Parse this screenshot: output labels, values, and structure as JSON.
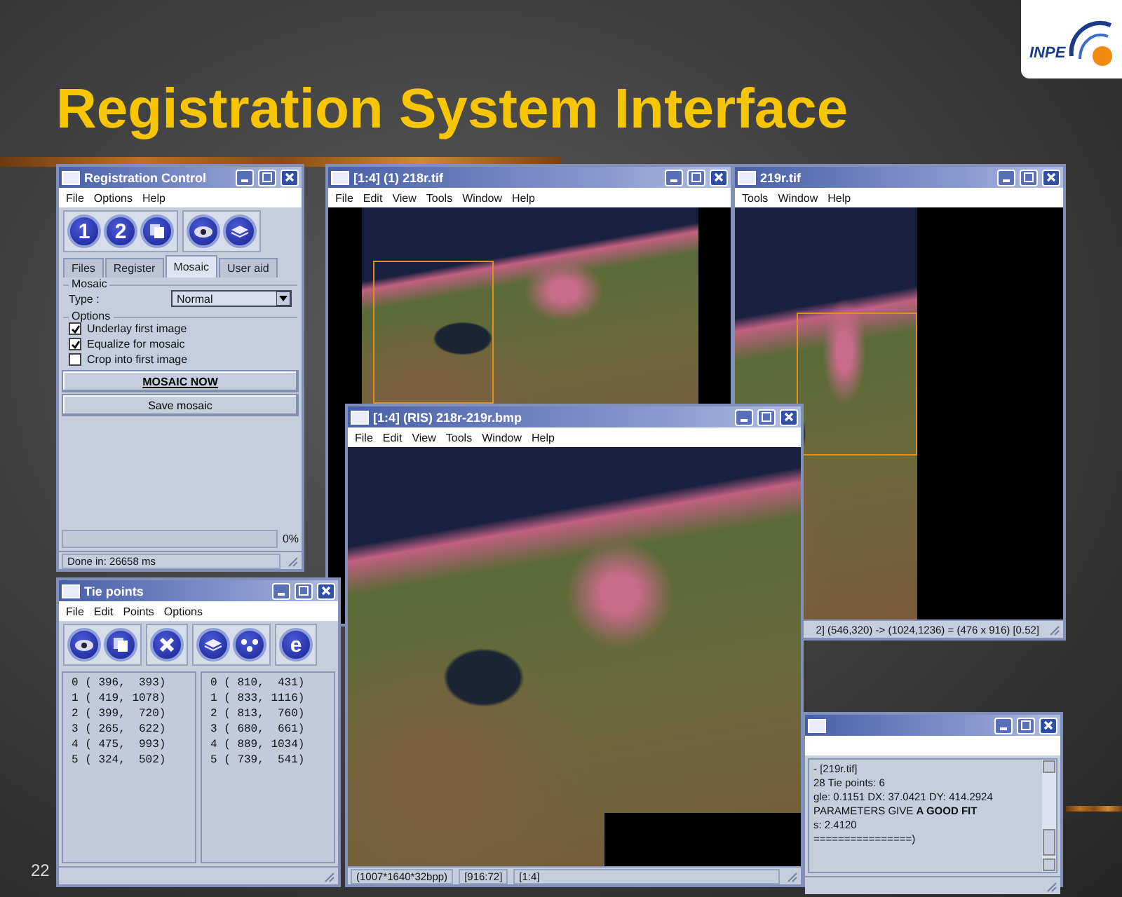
{
  "slide": {
    "title": "Registration System Interface",
    "logo": "INPE",
    "page_number": "22"
  },
  "registration_control": {
    "title": "Registration Control",
    "menu": [
      "File",
      "Options",
      "Help"
    ],
    "toolbar": [
      [
        {
          "kind": "label",
          "label": "1"
        },
        {
          "kind": "label",
          "label": "2"
        },
        {
          "kind": "pages"
        }
      ],
      [
        {
          "kind": "eye"
        },
        {
          "kind": "stack"
        }
      ]
    ],
    "tabs": [
      {
        "label": "Files",
        "selected": false
      },
      {
        "label": "Register",
        "selected": false
      },
      {
        "label": "Mosaic",
        "selected": true
      },
      {
        "label": "User aid",
        "selected": false
      }
    ],
    "mosaic_group": {
      "label": "Mosaic",
      "type_label": "Type :",
      "type_value": "Normal"
    },
    "options_group": {
      "label": "Options",
      "options": [
        {
          "label": "Underlay first image",
          "checked": true
        },
        {
          "label": "Equalize for mosaic",
          "checked": true
        },
        {
          "label": "Crop into first image",
          "checked": false
        }
      ]
    },
    "buttons": [
      {
        "label": "MOSAIC NOW",
        "emphasized": true
      },
      {
        "label": "Save mosaic",
        "emphasized": false
      }
    ],
    "progress": {
      "level": 0,
      "reading": "0%"
    },
    "status": "Done in: 26658 ms"
  },
  "tie_points": {
    "title": "Tie points",
    "menu": [
      "File",
      "Edit",
      "Points",
      "Options"
    ],
    "toolbar": [
      [
        {
          "kind": "eye"
        },
        {
          "kind": "pages"
        }
      ],
      [
        {
          "kind": "cross"
        }
      ],
      [
        {
          "kind": "stack"
        },
        {
          "kind": "pointer"
        }
      ],
      [
        {
          "kind": "label",
          "label": "e"
        }
      ]
    ],
    "lists": [
      [
        "0 ( 396,  393)",
        "1 ( 419, 1078)",
        "2 ( 399,  720)",
        "3 ( 265,  622)",
        "4 ( 475,  993)",
        "5 ( 324,  502)"
      ],
      [
        "0 ( 810,  431)",
        "1 ( 833, 1116)",
        "2 ( 813,  760)",
        "3 ( 680,  661)",
        "4 ( 889, 1034)",
        "5 ( 739,  541)"
      ]
    ]
  },
  "image_windows": [
    {
      "title": "[1:4] (1)  218r.tif",
      "menu": [
        "File",
        "Edit",
        "View",
        "Tools",
        "Window",
        "Help"
      ]
    },
    {
      "title": "219r.tif",
      "menu": [
        "Tools",
        "Window",
        "Help"
      ],
      "status": [
        "2] (546,320) -> (1024,1236) = (476 x 916) [0.52]"
      ]
    },
    {
      "title": "[1:4] (RIS)  218r-219r.bmp",
      "menu": [
        "File",
        "Edit",
        "View",
        "Tools",
        "Window",
        "Help"
      ],
      "status": [
        "(1007*1640*32bpp)",
        "[916:72]",
        "[1:4]"
      ]
    }
  ],
  "log_window": {
    "lines": [
      "- [219r.tif]",
      "28 Tie points: 6",
      "gle: 0.1151 DX: 37.0421 DY: 414.2924",
      "PARAMETERS GIVE **A GOOD FIT**",
      "s: 2.4120",
      "================)"
    ]
  }
}
